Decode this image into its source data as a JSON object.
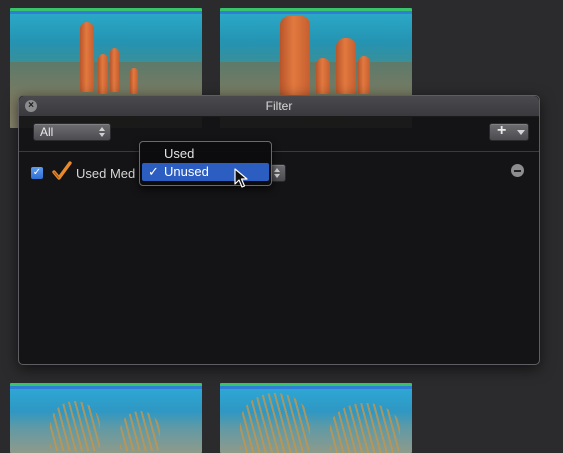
{
  "panel": {
    "title": "Filter",
    "close_symbol": "×",
    "match_select": {
      "value": "All"
    },
    "add_button": {
      "symbol": "+"
    }
  },
  "rule": {
    "checked": true,
    "check_symbol": "✓",
    "icon": "orange-checkmark-icon",
    "label": "Used Med",
    "selected_value": "Unused"
  },
  "menu": {
    "items": [
      {
        "label": "Used",
        "checked": false,
        "check_symbol": ""
      },
      {
        "label": "Unused",
        "checked": true,
        "check_symbol": "✓"
      }
    ]
  },
  "colors": {
    "highlight": "#2c5ec2",
    "checkbox": "#3b7fe0",
    "rule_icon": "#e8892c",
    "clip_top_green": "#37c46a",
    "clip_top_blue": "#2f7fd6"
  }
}
